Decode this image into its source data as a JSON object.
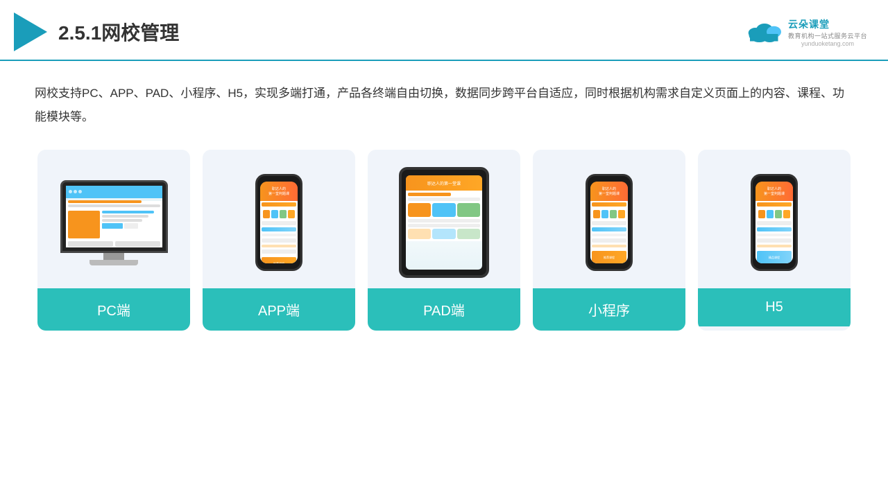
{
  "header": {
    "title": "2.5.1网校管理",
    "brand_name": "云朵课堂",
    "brand_sub": "教育机构一站式服务云平台",
    "brand_url": "yunduoketang.com"
  },
  "description": "网校支持PC、APP、PAD、小程序、H5，实现多端打通，产品各终端自由切换，数据同步跨平台自适应，同时根据机构需求自定义页面上的内容、课程、功能模块等。",
  "cards": [
    {
      "id": "pc",
      "label": "PC端"
    },
    {
      "id": "app",
      "label": "APP端"
    },
    {
      "id": "pad",
      "label": "PAD端"
    },
    {
      "id": "miniprogram",
      "label": "小程序"
    },
    {
      "id": "h5",
      "label": "H5"
    }
  ],
  "accent_color": "#2bbfba"
}
